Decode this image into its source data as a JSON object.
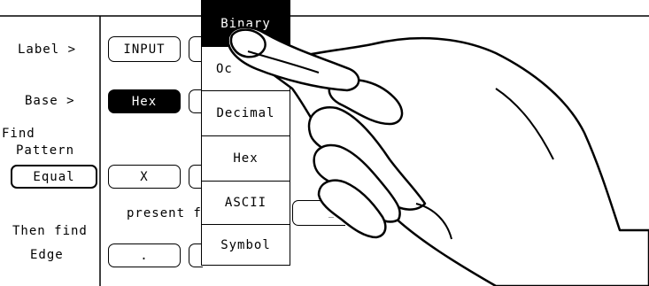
{
  "left_panel": {
    "label_key": "Label >",
    "base_key": "Base >",
    "find_line1": "Find",
    "find_line2": "Pattern",
    "find_mode": "Equal",
    "then_line1": "Then find",
    "then_line2": "Edge"
  },
  "fields": {
    "label_value": "INPUT",
    "base_value": "Hex",
    "pattern_value": "X",
    "present_text": "present f",
    "edge_value": ".",
    "partial_right_value": "_"
  },
  "base_menu": {
    "items": [
      "Binary",
      "Oc",
      "Decimal",
      "Hex",
      "ASCII",
      "Symbol"
    ],
    "selected": "Binary"
  },
  "icons": {
    "pointer": "hand-pointer-icon"
  }
}
